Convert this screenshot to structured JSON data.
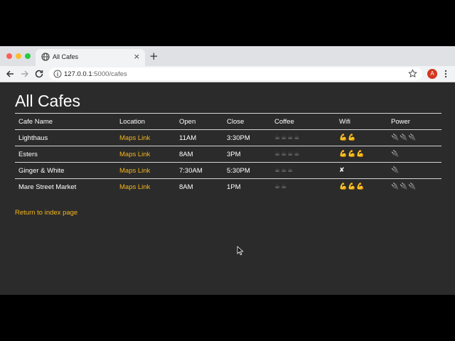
{
  "browser": {
    "tab_title": "All Cafes",
    "url_host": "127.0.0.1",
    "url_path": ":5000/cafes",
    "new_tab_label": "+",
    "tab_close_label": "×",
    "avatar_letter": "A"
  },
  "page": {
    "title": "All Cafes",
    "return_link": "Return to index page"
  },
  "table": {
    "headers": [
      "Cafe Name",
      "Location",
      "Open",
      "Close",
      "Coffee",
      "Wifi",
      "Power"
    ],
    "rows": [
      {
        "name": "Lighthaus",
        "location": "Maps Link",
        "open": "11AM",
        "close": "3:30PM",
        "coffee": "☕☕☕☕",
        "wifi": "💪💪",
        "power": "🔌🔌🔌",
        "coffee_rating": 4,
        "wifi_rating": 2,
        "power_rating": 3
      },
      {
        "name": "Esters",
        "location": "Maps Link",
        "open": "8AM",
        "close": "3PM",
        "coffee": "☕☕☕☕",
        "wifi": "💪💪💪",
        "power": "🔌",
        "coffee_rating": 4,
        "wifi_rating": 3,
        "power_rating": 1
      },
      {
        "name": "Ginger & White",
        "location": "Maps Link",
        "open": "7:30AM",
        "close": "5:30PM",
        "coffee": "☕☕☕",
        "wifi": "✘",
        "power": "🔌",
        "coffee_rating": 3,
        "wifi_rating": 0,
        "power_rating": 1
      },
      {
        "name": "Mare Street Market",
        "location": "Maps Link",
        "open": "8AM",
        "close": "1PM",
        "coffee": "☕☕",
        "wifi": "💪💪💪",
        "power": "🔌🔌🔌",
        "coffee_rating": 2,
        "wifi_rating": 3,
        "power_rating": 3
      }
    ]
  },
  "colors": {
    "page_background": "#2b2b2b",
    "link": "#f5b51c",
    "text": "#ffffff"
  }
}
